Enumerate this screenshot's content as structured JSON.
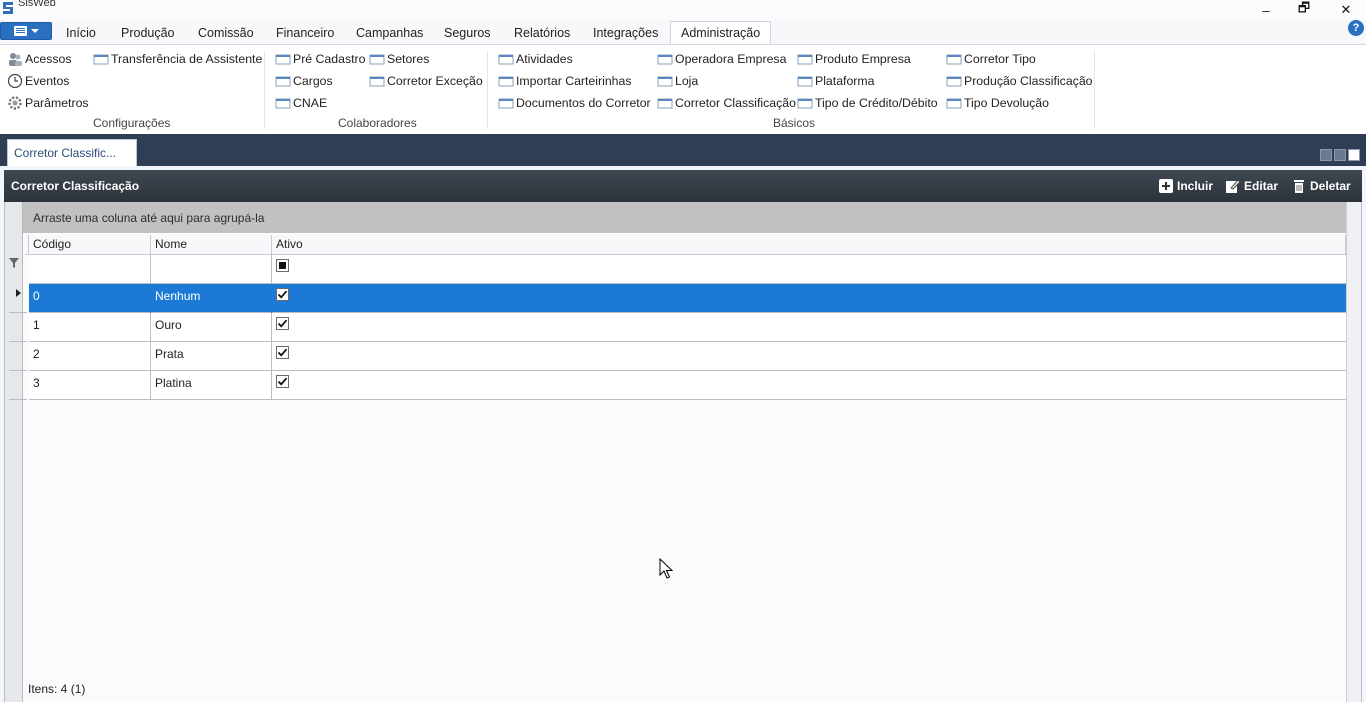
{
  "window": {
    "title": "SisWeb",
    "minimize": "–",
    "restore": "🗗",
    "close": "✕"
  },
  "ribbon_tabs": [
    "Início",
    "Produção",
    "Comissão",
    "Financeiro",
    "Campanhas",
    "Seguros",
    "Relatórios",
    "Integrações",
    "Administração"
  ],
  "active_tab": "Administração",
  "help": "?",
  "groups": {
    "configuracoes": {
      "label": "Configurações",
      "items": [
        "Acessos",
        "Eventos",
        "Parâmetros",
        "Transferência de Assistente"
      ]
    },
    "colaboradores": {
      "label": "Colaboradores",
      "items": [
        "Pré Cadastro",
        "Cargos",
        "CNAE",
        "Setores",
        "Corretor Exceção"
      ]
    },
    "basicos": {
      "label": "Básicos",
      "items": [
        "Atividades",
        "Importar Carteirinhas",
        "Documentos do Corretor",
        "Operadora Empresa",
        "Loja",
        "Corretor Classificação",
        "Produto Empresa",
        "Plataforma",
        "Tipo de Crédito/Débito",
        "Corretor Tipo",
        "Produção Classificação",
        "Tipo Devolução"
      ]
    }
  },
  "document_tab": "Corretor Classific...",
  "panel": {
    "title": "Corretor Classificação",
    "buttons": {
      "add": "Incluir",
      "edit": "Editar",
      "delete": "Deletar"
    }
  },
  "grid": {
    "group_hint": "Arraste uma coluna até aqui para agrupá-la",
    "columns": [
      "Código",
      "Nome",
      "Ativo"
    ],
    "rows": [
      {
        "codigo": "0",
        "nome": "Nenhum",
        "ativo": true
      },
      {
        "codigo": "1",
        "nome": "Ouro",
        "ativo": true
      },
      {
        "codigo": "2",
        "nome": "Prata",
        "ativo": true
      },
      {
        "codigo": "3",
        "nome": "Platina",
        "ativo": true
      }
    ],
    "selected_row": 0,
    "footer": "Itens: 4 (1)"
  }
}
